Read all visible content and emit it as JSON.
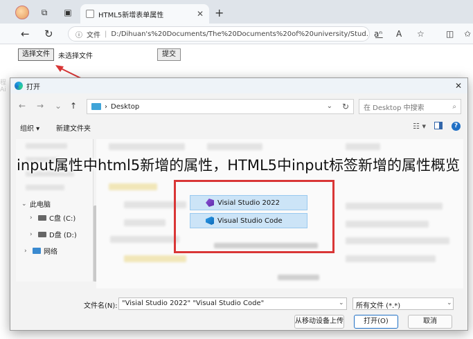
{
  "browser": {
    "tab_title": "HTML5新增表单属性",
    "left_edge_text": "程Ai",
    "address_label": "文件",
    "url": "D:/Dihuan's%20Documents/The%20Documents%20of%20university/Stud..."
  },
  "page": {
    "choose_file_label": "选择文件",
    "no_file_text": "未选择文件",
    "submit_label": "提交"
  },
  "dialog": {
    "title": "打开",
    "path": "Desktop",
    "search_placeholder": "在 Desktop 中搜索",
    "toolbar": {
      "organize": "组织",
      "new_folder": "新建文件夹"
    },
    "nav_items": [
      {
        "label": "此电脑"
      },
      {
        "label": "C盘 (C:)"
      },
      {
        "label": "D盘 (D:)"
      },
      {
        "label": "网络"
      }
    ],
    "selected_files": [
      {
        "name": "Visial Studio 2022",
        "icon": "visual-studio-icon"
      },
      {
        "name": "Visual Studio Code",
        "icon": "vscode-icon"
      }
    ],
    "filename_label": "文件名(N):",
    "filename_value": "\"Visial Studio 2022\" \"Visual Studio Code\"",
    "filetype_value": "所有文件 (*.*)",
    "upload_mobile": "从移动设备上传",
    "open_button": "打开(O)",
    "cancel_button": "取消"
  },
  "caption": "input属性中html5新增的属性，HTML5中input标签新增的属性概览",
  "colors": {
    "accent": "#1f6fc4",
    "highlight_rect": "#d93636",
    "selection_bg": "#cce4f7"
  }
}
